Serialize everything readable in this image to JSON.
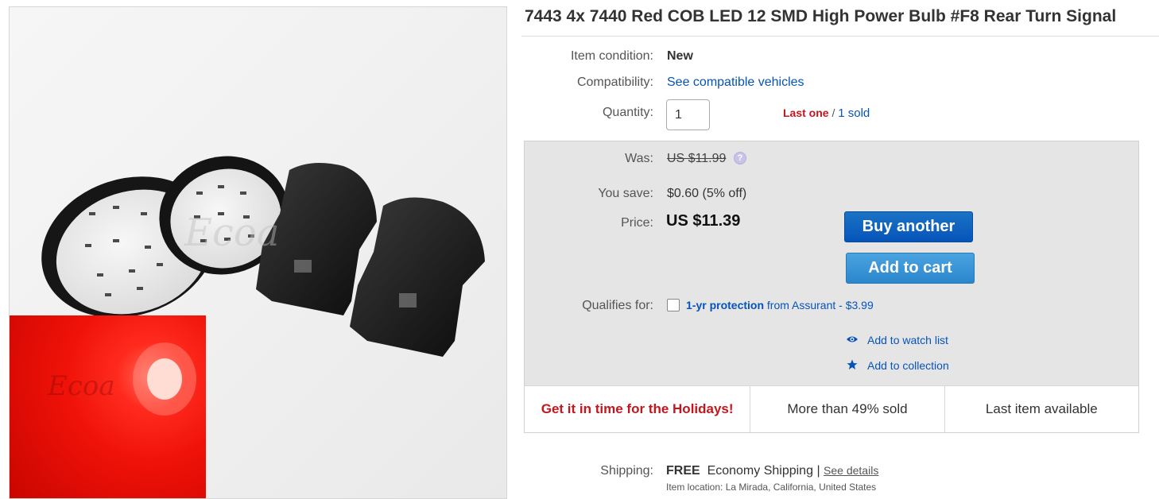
{
  "title": "7443 4x 7440 Red COB LED 12 SMD High Power Bulb #F8 Rear Turn Signal",
  "item": {
    "condition_label": "Item condition:",
    "condition_value": "New",
    "compat_label": "Compatibility:",
    "compat_link": "See compatible vehicles",
    "quantity_label": "Quantity:",
    "quantity_value": "1",
    "last_one": "Last one",
    "separator": "/",
    "sold_link": "1 sold"
  },
  "pricing": {
    "was_label": "Was:",
    "was_value": "US $11.99",
    "help_glyph": "?",
    "save_label": "You save:",
    "save_value": "$0.60 (5% off)",
    "price_label": "Price:",
    "price_value": "US $11.39",
    "buy_label": "Buy another",
    "cart_label": "Add to cart",
    "qualifies_label": "Qualifies for:",
    "protection_bold": "1-yr protection",
    "protection_rest": " from Assurant - $3.99",
    "watch_label": "Add to watch list",
    "collection_label": "Add to collection"
  },
  "promos": [
    "Get it in time for the Holidays!",
    "More than 49% sold",
    "Last item available"
  ],
  "shipping": {
    "label": "Shipping:",
    "free": "FREE",
    "method": "Economy Shipping",
    "divider": "|",
    "details_link": "See details",
    "location": "Item location:  La Mirada, California, United States"
  },
  "image": {
    "watermark": "Ecoa"
  },
  "colors": {
    "link_blue": "#0654ba",
    "alert_red": "#c4161c",
    "buy_button": "#0654ba",
    "cart_button": "#2a86cc",
    "price_box_bg": "#e5e5e5"
  },
  "icons": [
    "help-icon",
    "eye-icon",
    "star-icon"
  ]
}
